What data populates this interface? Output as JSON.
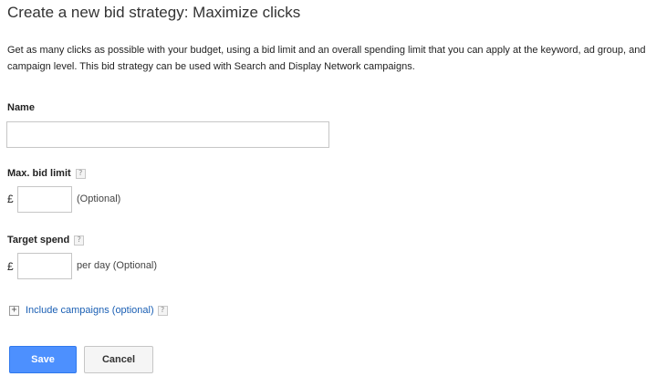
{
  "header": {
    "title": "Create a new bid strategy: Maximize clicks"
  },
  "description": "Get as many clicks as possible with your budget, using a bid limit and an overall spending limit that you can apply at the keyword, ad group, and campaign level. This bid strategy can be used with Search and Display Network campaigns.",
  "name_field": {
    "label": "Name",
    "value": "",
    "placeholder": ""
  },
  "max_bid": {
    "label": "Max. bid limit",
    "help": "?",
    "currency": "£",
    "value": "",
    "hint": "(Optional)"
  },
  "target_spend": {
    "label": "Target spend",
    "help": "?",
    "currency": "£",
    "value": "",
    "hint": "per day (Optional)"
  },
  "include_campaigns": {
    "expand": "+",
    "label": "Include campaigns (optional)",
    "help": "?"
  },
  "actions": {
    "save_label": "Save",
    "cancel_label": "Cancel"
  },
  "colors": {
    "primary_button": "#4d90fe",
    "link": "#1a5fb4"
  },
  "icons": {
    "help": "help-question-icon",
    "expand": "plus-box-icon"
  }
}
